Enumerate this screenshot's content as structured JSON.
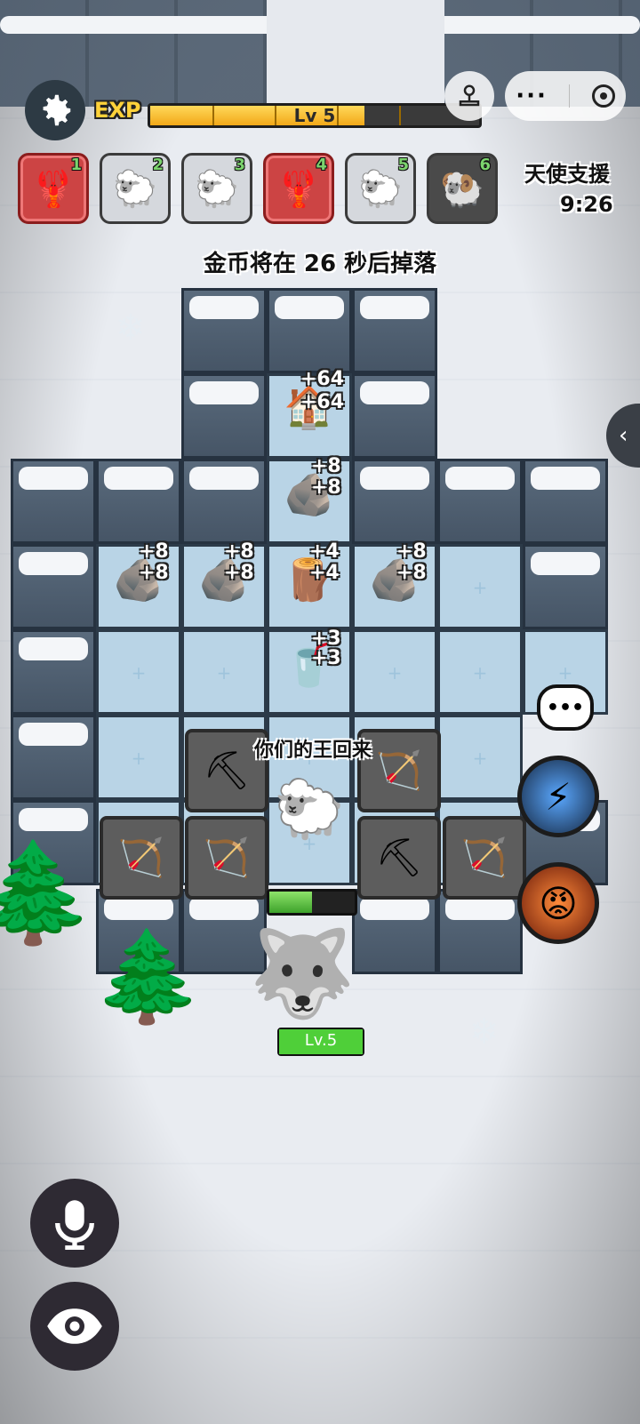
{
  "hud": {
    "exp_label": "EXP",
    "level_text": "Lv 5",
    "exp_fraction": 0.65
  },
  "slots": [
    {
      "num": "1",
      "icon": "claw-icon",
      "glyph": "🦞",
      "style": "red"
    },
    {
      "num": "2",
      "icon": "sheep-icon",
      "glyph": "🐑",
      "style": "plain"
    },
    {
      "num": "3",
      "icon": "jiangshi-sheep-icon",
      "glyph": "🐑",
      "style": "plain"
    },
    {
      "num": "4",
      "icon": "claw-icon",
      "glyph": "🦞",
      "style": "red"
    },
    {
      "num": "5",
      "icon": "chef-sheep-icon",
      "glyph": "🐑",
      "style": "plain"
    },
    {
      "num": "6",
      "icon": "demon-sheep-icon",
      "glyph": "🐏",
      "style": "dark"
    }
  ],
  "angel_support": {
    "label": "天使支援",
    "timer": "9:26"
  },
  "coin_message": "金币将在 26 秒后掉落",
  "board": {
    "house_yield": [
      "+64",
      "+64"
    ],
    "rocks": [
      {
        "yield": [
          "+8",
          "+8"
        ]
      },
      {
        "yield": [
          "+8",
          "+8"
        ]
      },
      {
        "yield": [
          "+8",
          "+8"
        ]
      },
      {
        "yield": [
          "+8",
          "+8"
        ]
      }
    ],
    "wood_yield": [
      "+4",
      "+4"
    ],
    "cup_yield": [
      "+3",
      "+3"
    ]
  },
  "speech": "你们的王回来",
  "player_hp_fraction": 0.5,
  "enemy": {
    "level": "Lv.5",
    "hp_fraction": 1.0
  },
  "colors": {
    "accent": "#ffd23a",
    "hp_green": "#4fcf39",
    "enemy": "#c2452b"
  }
}
